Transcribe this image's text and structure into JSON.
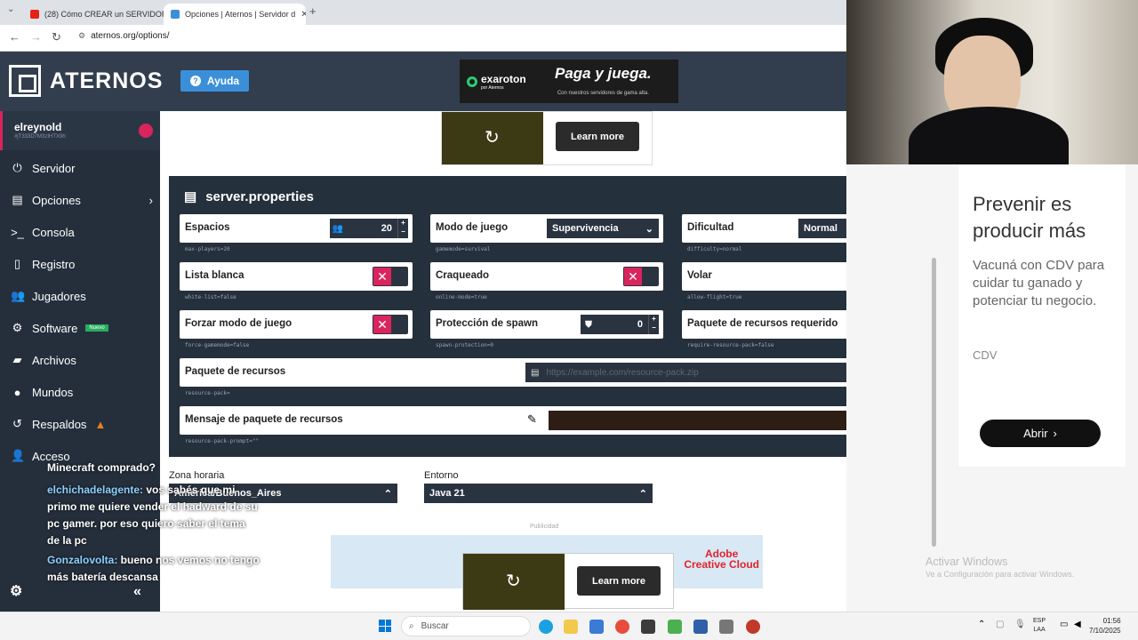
{
  "browser": {
    "tabs": [
      {
        "title": "(28) Cómo CREAR un SERVIDOR",
        "favicon_color": "#e62117"
      },
      {
        "title": "Opciones | Aternos | Servidor d",
        "favicon_color": "#3b8fd9"
      }
    ],
    "new_tab": "+",
    "url": "aternos.org/options/"
  },
  "header": {
    "logo_text": "ATERNOS",
    "help_label": "Ayuda",
    "banner": {
      "brand": "exaroton",
      "brand_sub": "por Aternos",
      "headline": "Paga y juega.",
      "sub": "Con nuestros servidores de gama alta."
    }
  },
  "sidebar": {
    "username": "elreynold",
    "user_id": "#jT333D7M3zIHTX9h",
    "items": [
      {
        "label": "Servidor",
        "icon": "power-icon"
      },
      {
        "label": "Opciones",
        "icon": "options-icon"
      },
      {
        "label": "Consola",
        "icon": "terminal-icon"
      },
      {
        "label": "Registro",
        "icon": "log-icon"
      },
      {
        "label": "Jugadores",
        "icon": "players-icon"
      },
      {
        "label": "Software",
        "icon": "software-icon",
        "badge": "Nuevo"
      },
      {
        "label": "Archivos",
        "icon": "folder-icon"
      },
      {
        "label": "Mundos",
        "icon": "globe-icon"
      },
      {
        "label": "Respaldos",
        "icon": "backup-icon"
      },
      {
        "label": "Acceso",
        "icon": "access-icon"
      }
    ]
  },
  "chat": {
    "lines": [
      {
        "text": "Minecraft comprado?"
      },
      {
        "name": "elchichadelagente:",
        "text": " vos sabés que mi primo me quiere vender el hadward de su pc gamer. por eso quiero saber el tema de la pc"
      },
      {
        "name": "Gonzalovolta:",
        "text": " bueno nos vemos no tengo más batería descansa"
      }
    ]
  },
  "ad_top": {
    "learn_more": "Learn more"
  },
  "properties": {
    "title": "server.properties",
    "rows": [
      {
        "label": "Espacios",
        "key": "max-players=20",
        "type": "number",
        "value": "20"
      },
      {
        "label": "Modo de juego",
        "key": "gamemode=survival",
        "type": "select",
        "value": "Supervivencia"
      },
      {
        "label": "Dificultad",
        "key": "difficulty=normal",
        "type": "select",
        "value": "Normal"
      },
      {
        "label": "Lista blanca",
        "key": "white-list=false",
        "type": "toggle",
        "on": false
      },
      {
        "label": "Craqueado",
        "key": "online-mode=true",
        "type": "toggle",
        "on": false
      },
      {
        "label": "Volar",
        "key": "allow-flight=true",
        "type": "toggle",
        "on": true
      },
      {
        "label": "Forzar modo de juego",
        "key": "force-gamemode=false",
        "type": "toggle",
        "on": false
      },
      {
        "label": "Protección de spawn",
        "key": "spawn-protection=0",
        "type": "number",
        "value": "0"
      },
      {
        "label": "Paquete de recursos requerido",
        "key": "require-resource-pack=false",
        "type": "toggle",
        "on": false
      }
    ],
    "resource_pack": {
      "label": "Paquete de recursos",
      "key": "resource-pack=",
      "placeholder": "https://example.com/resource-pack.zip"
    },
    "resource_prompt": {
      "label": "Mensaje de paquete de recursos",
      "key": "resource-pack-prompt=\"\""
    }
  },
  "timezone": {
    "label": "Zona horaria",
    "value": "America/Buenos_Aires"
  },
  "environment": {
    "label": "Entorno",
    "value": "Java 21"
  },
  "ad_bottom": {
    "publicidad": "Publicidad",
    "learn_more": "Learn more",
    "adobe_line1": "Adobe",
    "adobe_line2": "Creative Cloud"
  },
  "right_ad": {
    "headline": "Prevenir es producir más",
    "body": "Vacuná con CDV para cuidar tu ganado y potenciar tu negocio.",
    "brand": "CDV",
    "cta": "Abrir"
  },
  "activate_windows": {
    "title": "Activar Windows",
    "sub": "Ve a Configuración para activar Windows."
  },
  "taskbar": {
    "search": "Buscar",
    "lang1": "ESP",
    "lang2": "LAA",
    "time": "01:56",
    "date": "7/10/2025"
  }
}
